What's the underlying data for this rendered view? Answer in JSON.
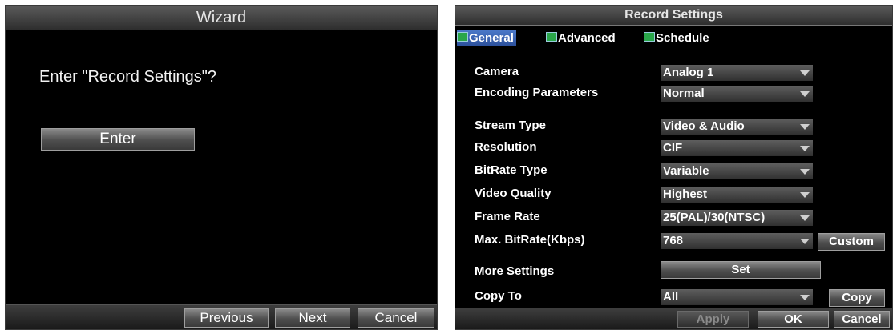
{
  "wizard": {
    "title": "Wizard",
    "question": "Enter \"Record Settings\"?",
    "enter_label": "Enter",
    "previous_label": "Previous",
    "next_label": "Next",
    "cancel_label": "Cancel"
  },
  "record": {
    "title": "Record Settings",
    "tabs": [
      {
        "label": "General",
        "icon": "tab-icon"
      },
      {
        "label": "Advanced",
        "icon": "tab-icon"
      },
      {
        "label": "Schedule",
        "icon": "tab-icon"
      }
    ],
    "fields": [
      {
        "label": "Camera",
        "value": "Analog 1"
      },
      {
        "label": "Encoding Parameters",
        "value": "Normal"
      },
      {
        "label": "Stream Type",
        "value": "Video & Audio"
      },
      {
        "label": "Resolution",
        "value": "CIF"
      },
      {
        "label": "BitRate Type",
        "value": "Variable"
      },
      {
        "label": "Video Quality",
        "value": "Highest"
      },
      {
        "label": "Frame Rate",
        "value": "25(PAL)/30(NTSC)"
      },
      {
        "label": "Max. BitRate(Kbps)",
        "value": "768"
      },
      {
        "label": "More Settings",
        "value": ""
      },
      {
        "label": "Copy To",
        "value": "All"
      }
    ],
    "custom_label": "Custom",
    "set_label": "Set",
    "copy_label": "Copy",
    "apply_label": "Apply",
    "ok_label": "OK",
    "cancel_label": "Cancel"
  },
  "colors": {
    "background": "#000000",
    "active_tab": "#3a64b4",
    "text": "#ffffff"
  }
}
